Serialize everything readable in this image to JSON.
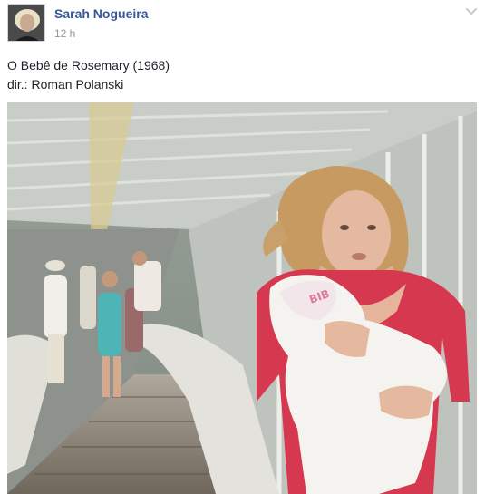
{
  "post": {
    "author": "Sarah Nogueira",
    "timestamp": "12 h",
    "text_lines": [
      "O Bebê de Rosemary (1968)",
      "dir.: Roman Polanski"
    ]
  },
  "icons": {
    "options": "chevron-down-icon"
  },
  "colors": {
    "author_link": "#365899",
    "timestamp": "#90949c",
    "body_text": "#1d2129"
  }
}
